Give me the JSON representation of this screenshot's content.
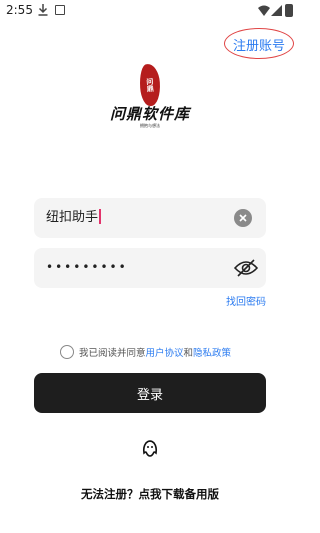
{
  "status_bar": {
    "time": "2:55",
    "icons": [
      "download-icon",
      "font-icon",
      "wifi-icon",
      "signal-icon",
      "battery-icon"
    ]
  },
  "header": {
    "register_label": "注册账号"
  },
  "logo": {
    "seal_text": "问鼎",
    "name": "问鼎软件库",
    "subtitle": "拥抱与想法"
  },
  "form": {
    "username_value": "纽扣助手",
    "password_mask": "•••••••••",
    "forgot_label": "找回密码"
  },
  "agreement": {
    "prefix": "我已阅读并同意",
    "user_agreement": "用户协议",
    "and": "和",
    "privacy_policy": "隐私政策"
  },
  "login_label": "登录",
  "footer": {
    "backup_label": "无法注册？点我下载备用版"
  },
  "colors": {
    "accent": "#2b7bf0",
    "button": "#1e1e1e",
    "highlight_ellipse": "#e04545",
    "seal": "#b51d1d"
  }
}
